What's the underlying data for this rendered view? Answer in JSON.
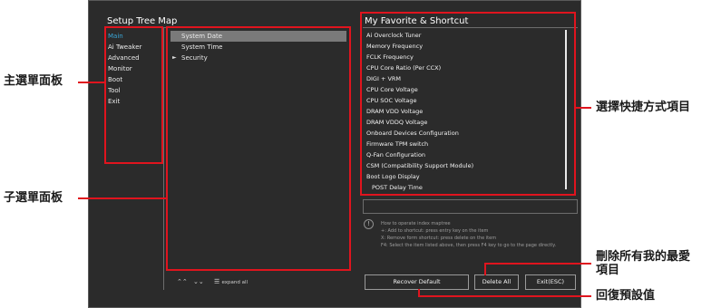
{
  "panels": {
    "tree_title": "Setup Tree Map",
    "fav_title": "My Favorite & Shortcut"
  },
  "main_menu": {
    "items": [
      {
        "label": "Main",
        "active": true
      },
      {
        "label": "Ai Tweaker"
      },
      {
        "label": "Advanced"
      },
      {
        "label": "Monitor"
      },
      {
        "label": "Boot"
      },
      {
        "label": "Tool"
      },
      {
        "label": "Exit"
      }
    ]
  },
  "sub_menu": {
    "items": [
      {
        "label": "System Date",
        "selected": true
      },
      {
        "label": "System Time"
      },
      {
        "label": "Security",
        "arrow": "►"
      }
    ]
  },
  "favorites": {
    "items": [
      "Ai Overclock Tuner",
      "Memory Frequency",
      "FCLK Frequency",
      "CPU Core Ratio (Per CCX)",
      "DIGI + VRM",
      "CPU Core Voltage",
      "CPU SOC Voltage",
      "DRAM VDD Voltage",
      "DRAM VDDQ Voltage",
      "Onboard Devices Configuration",
      "Firmware TPM switch",
      "Q-Fan Configuration",
      "CSM (Compatibility Support Module)",
      "Boot Logo Display",
      "POST Delay Time"
    ]
  },
  "help": {
    "icon_glyph": "!",
    "lines": [
      "How to operate index maptree",
      "+: Add to shortcut: press entry key on the item",
      "X: Remove form shortcut: press delete on the item",
      "F4: Select the item listed above, then press F4 key to go to the page directly."
    ]
  },
  "toolbar": {
    "expand_glyph": "⌃⌃",
    "collapse_glyph": "⌄⌄",
    "expand_all_glyph": "☰",
    "expand_all_label": "expand all"
  },
  "buttons": {
    "recover_default": "Recover Default",
    "delete_all": "Delete All",
    "exit": "Exit(ESC)"
  },
  "callouts": {
    "main_menu": "主選單面板",
    "sub_menu": "子選單面板",
    "shortcut": "選擇快捷方式項目",
    "delete_all_line1": "刪除所有我的最愛",
    "delete_all_line2": "項目",
    "recover_default": "回復預設值"
  },
  "colors": {
    "annotation_red": "#e0141e",
    "active_menu": "#3aa7d8",
    "screen_bg": "#2b2b2b"
  }
}
